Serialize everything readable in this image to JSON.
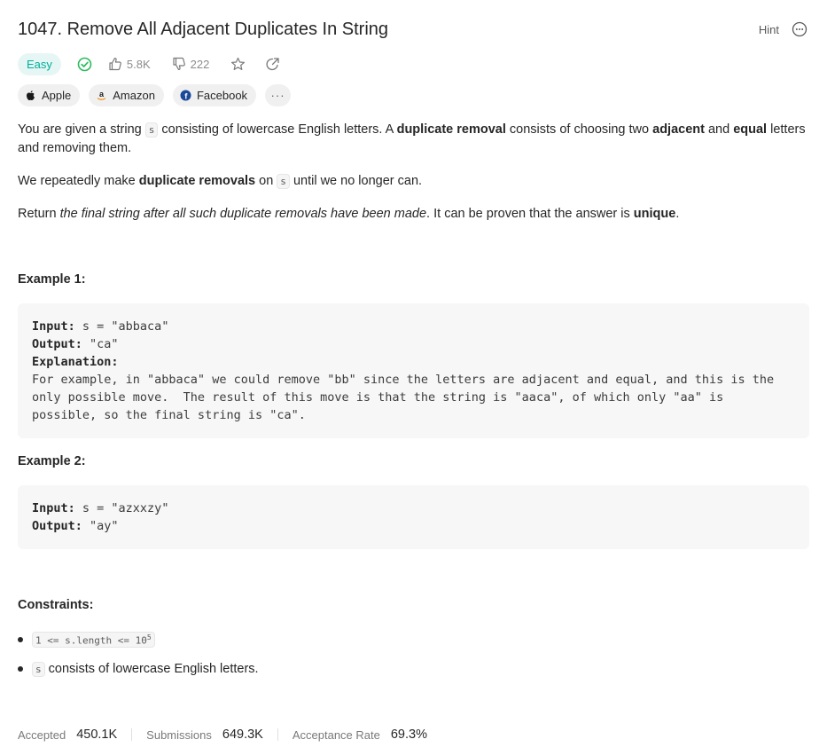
{
  "problem": {
    "title": "1047. Remove All Adjacent Duplicates In String",
    "difficulty": "Easy",
    "likes": "5.8K",
    "dislikes": "222",
    "hint_label": "Hint"
  },
  "tags": [
    {
      "label": "Apple",
      "icon": "apple-icon"
    },
    {
      "label": "Amazon",
      "icon": "amazon-icon"
    },
    {
      "label": "Facebook",
      "icon": "facebook-icon"
    }
  ],
  "tags_more": "···",
  "description": {
    "p1": {
      "t1": "You are given a string ",
      "code": "s",
      "t2": " consisting of lowercase English letters. A ",
      "b1": "duplicate removal",
      "t3": " consists of choosing two ",
      "b2": "adjacent",
      "t4": " and ",
      "b3": "equal",
      "t5": " letters and removing them."
    },
    "p2": {
      "t1": "We repeatedly make ",
      "b1": "duplicate removals",
      "t2": " on ",
      "code": "s",
      "t3": " until we no longer can."
    },
    "p3": {
      "t1": "Return ",
      "i1": "the final string after all such duplicate removals have been made",
      "t2": ". It can be proven that the answer is ",
      "b1": "unique",
      "t3": "."
    }
  },
  "examples": [
    {
      "title": "Example 1:",
      "input_label": "Input:",
      "input": " s = \"abbaca\"",
      "output_label": "Output:",
      "output": " \"ca\"",
      "explanation_label": "Explanation:",
      "explanation": "For example, in \"abbaca\" we could remove \"bb\" since the letters are adjacent and equal, and this is the only possible move.  The result of this move is that the string is \"aaca\", of which only \"aa\" is possible, so the final string is \"ca\"."
    },
    {
      "title": "Example 2:",
      "input_label": "Input:",
      "input": " s = \"azxxzy\"",
      "output_label": "Output:",
      "output": " \"ay\""
    }
  ],
  "constraints": {
    "title": "Constraints:",
    "c1_code": "1 <= s.length <= 10",
    "c1_sup": "5",
    "c2_code": "s",
    "c2_text": "consists of lowercase English letters."
  },
  "stats": [
    {
      "label": "Accepted",
      "value": "450.1K"
    },
    {
      "label": "Submissions",
      "value": "649.3K"
    },
    {
      "label": "Acceptance Rate",
      "value": "69.3%"
    }
  ],
  "colors": {
    "easy": "#00af9b",
    "solved_check": "#2cbb5d"
  }
}
